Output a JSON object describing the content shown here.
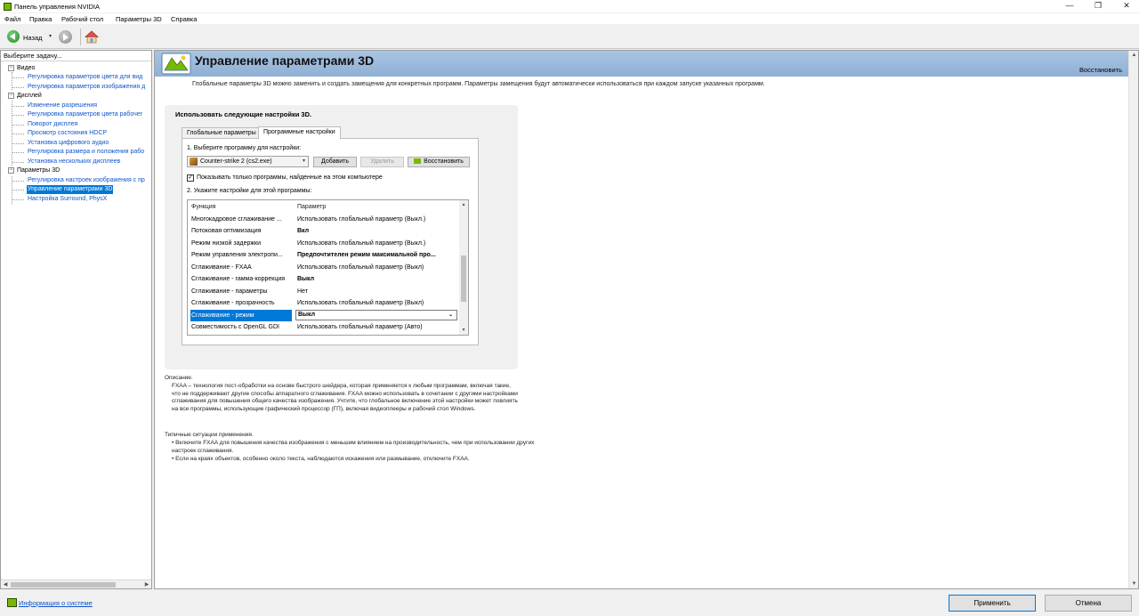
{
  "window": {
    "title": "Панель управления NVIDIA",
    "minimize": "—",
    "maximize": "❐",
    "close": "✕"
  },
  "menu": [
    "Файл",
    "Правка",
    "Рабочий стол",
    "Параметры 3D",
    "Справка"
  ],
  "toolbar": {
    "back_label": "Назад",
    "dropdown_glyph": "▾"
  },
  "sidebar": {
    "header": "Выберите задачу...",
    "tree": [
      {
        "type": "category",
        "label": "Видео",
        "toggle": "−"
      },
      {
        "type": "link",
        "label": "Регулировка параметров цвета для вид"
      },
      {
        "type": "link",
        "label": "Регулировка параметров изображения д"
      },
      {
        "type": "category",
        "label": "Дисплей",
        "toggle": "−"
      },
      {
        "type": "link",
        "label": "Изменение разрешения"
      },
      {
        "type": "link",
        "label": "Регулировка параметров цвета рабочег"
      },
      {
        "type": "link",
        "label": "Поворот дисплея"
      },
      {
        "type": "link",
        "label": "Просмотр состояния HDCP"
      },
      {
        "type": "link",
        "label": "Установка цифрового аудио"
      },
      {
        "type": "link",
        "label": "Регулировка размера и положения рабо"
      },
      {
        "type": "link",
        "label": "Установка нескольких дисплеев"
      },
      {
        "type": "category",
        "label": "Параметры 3D",
        "toggle": "−"
      },
      {
        "type": "link",
        "label": "Регулировка настроек изображения с пр"
      },
      {
        "type": "link",
        "label": "Управление параметрами 3D",
        "selected": true
      },
      {
        "type": "link",
        "label": "Настройка Surround, PhysX"
      }
    ],
    "scroll_left": "◀",
    "scroll_right": "▶"
  },
  "main": {
    "title": "Управление параметрами 3D",
    "restore": "Восстановить",
    "intro": "Глобальные параметры 3D можно заменить и создать замещения для конкретных программ. Параметры замещения будут автоматически использоваться при каждом запуске указанных программ.",
    "panel_heading": "Использовать следующие настройки 3D.",
    "tabs": [
      {
        "label": "Глобальные параметры",
        "active": false
      },
      {
        "label": "Программные настройки",
        "active": true
      }
    ],
    "step1": "1. Выберите программу для настройки:",
    "program": "Counter-strike 2 (cs2.exe)",
    "buttons": {
      "add": "Добавить",
      "remove": "Удалить",
      "restore": "Восстановить"
    },
    "checkbox_label": "Показывать только программы, найденные на этом компьютере",
    "checkbox_checked": true,
    "step2": "2. Укажите настройки для этой программы:",
    "grid": {
      "headers": [
        "Функция",
        "Параметр"
      ],
      "rows": [
        {
          "feature": "Многокадровое сглаживание ...",
          "value": "Использовать глобальный параметр (Выкл.)",
          "bold": false
        },
        {
          "feature": "Потоковая оптимизация",
          "value": "Вкл",
          "bold": true
        },
        {
          "feature": "Режим низкой задержки",
          "value": "Использовать глобальный параметр (Выкл.)",
          "bold": false
        },
        {
          "feature": "Режим управления электропи...",
          "value": "Предпочтителен режим максимальной про...",
          "bold": true
        },
        {
          "feature": "Сглаживание - FXAA",
          "value": "Использовать глобальный параметр (Выкл)",
          "bold": false
        },
        {
          "feature": "Сглаживание - гамма-коррекция",
          "value": "Выкл",
          "bold": true
        },
        {
          "feature": "Сглаживание - параметры",
          "value": "Нет",
          "bold": false
        },
        {
          "feature": "Сглаживание - прозрачность",
          "value": "Использовать глобальный параметр (Выкл)",
          "bold": false
        },
        {
          "feature": "Сглаживание - режим",
          "value": "Выкл",
          "bold": true,
          "selected": true
        },
        {
          "feature": "Совместимость с OpenGL GDI",
          "value": "Использовать глобальный параметр (Авто)",
          "bold": false
        }
      ]
    },
    "description": {
      "heading": "Описание.",
      "text": "FXAA – технология пост-обработки на основе быстрого шейдера, которая применяется к любым программам, включая такие, что не поддерживают другие способы аппаратного сглаживания. FXAA можно использовать в сочетании с другими настройками сглаживания для повышения общего качества изображения. Учтите, что глобальное включение этой настройки может повлиять на все программы, использующие графический процессор (ГП), включая видеоплееры и рабочий стол Windows."
    },
    "usage": {
      "heading": "Типичные ситуации применения.",
      "items": [
        "• Включите FXAA для повышения качества изображения с меньшим влиянием на производительность, чем при использовании других настроек сглаживания.",
        "• Если на краях объектов, особенно около текста, наблюдаются искажения или размывание, отключите FXAA."
      ]
    }
  },
  "footer": {
    "sysinfo": "Информация о системе",
    "apply": "Применить",
    "cancel": "Отмена"
  },
  "colors": {
    "accent": "#0078d7",
    "nvidia_green": "#76b900",
    "link": "#1155cc",
    "banner": "#9db9da"
  }
}
